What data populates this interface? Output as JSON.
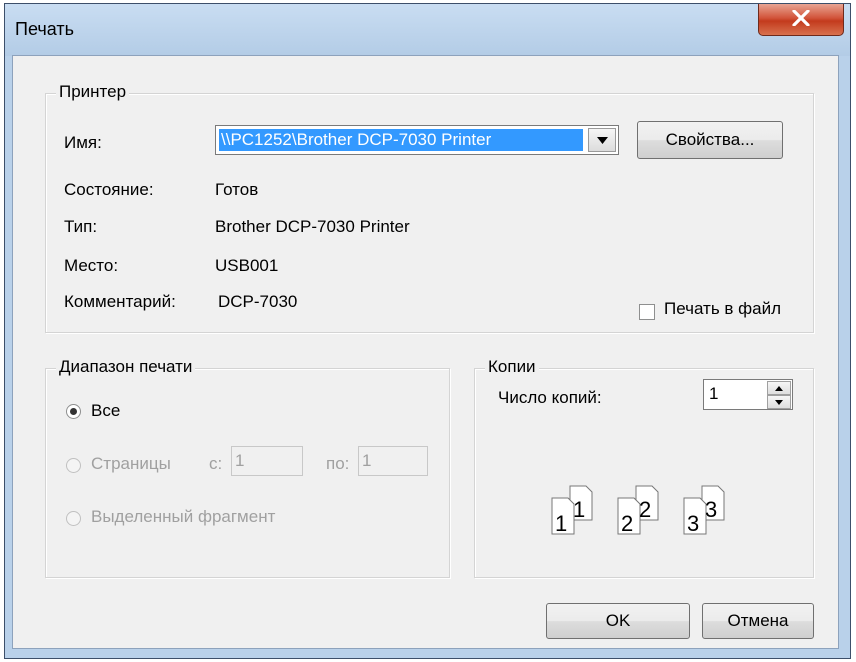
{
  "window": {
    "title": "Печать"
  },
  "printer": {
    "group_title": "Принтер",
    "name_label": "Имя:",
    "name_value": "\\\\PC1252\\Brother DCP-7030 Printer",
    "properties_button": "Свойства...",
    "status_label": "Состояние:",
    "status_value": "Готов",
    "type_label": "Тип:",
    "type_value": "Brother DCP-7030 Printer",
    "location_label": "Место:",
    "location_value": "USB001",
    "comment_label": "Комментарий:",
    "comment_value": "DCP-7030",
    "print_to_file_label": "Печать в файл",
    "print_to_file_checked": false
  },
  "print_range": {
    "group_title": "Диапазон печати",
    "all_label": "Все",
    "pages_label": "Страницы",
    "from_label": "с:",
    "from_value": "1",
    "to_label": "по:",
    "to_value": "1",
    "selection_label": "Выделенный фрагмент",
    "selected": "all"
  },
  "copies": {
    "group_title": "Копии",
    "count_label": "Число копий:",
    "count_value": "1",
    "collate_pages": [
      "1",
      "1",
      "2",
      "2",
      "3",
      "3"
    ]
  },
  "buttons": {
    "ok": "OK",
    "cancel": "Отмена"
  }
}
